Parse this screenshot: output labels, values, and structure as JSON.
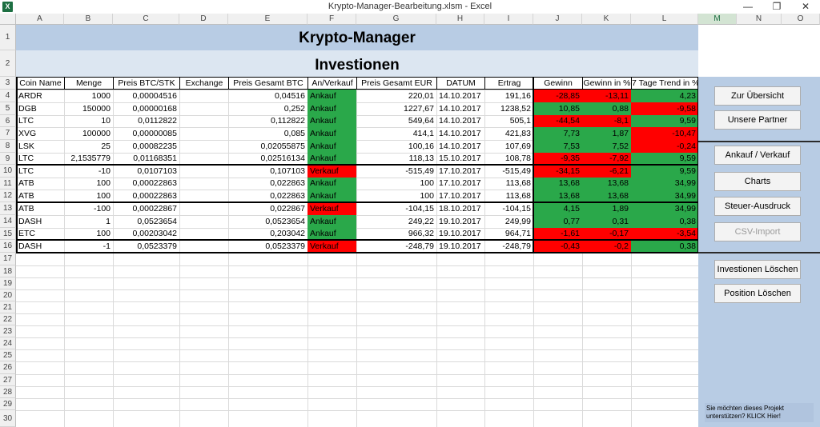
{
  "window": {
    "logo": "X",
    "title": "Krypto-Manager-Bearbeitung.xlsm - Excel",
    "controls": {
      "minimize": "—",
      "restore": "❐",
      "close": "✕"
    }
  },
  "columns": [
    "A",
    "B",
    "C",
    "D",
    "E",
    "F",
    "G",
    "H",
    "I",
    "J",
    "K",
    "L",
    "M",
    "N",
    "O"
  ],
  "row_numbers": [
    "1",
    "2",
    "3",
    "4",
    "5",
    "6",
    "7",
    "8",
    "9",
    "10",
    "11",
    "12",
    "13",
    "14",
    "15",
    "16",
    "17",
    "18",
    "19",
    "20",
    "21",
    "22",
    "23",
    "24",
    "25",
    "26",
    "27",
    "28",
    "29",
    "30"
  ],
  "sheet": {
    "title": "Krypto-Manager",
    "subtitle": "Investionen",
    "headers": [
      "Coin Name",
      "Menge",
      "Preis BTC/STK",
      "Exchange",
      "Preis Gesamt BTC",
      "An/Verkauf",
      "Preis Gesamt EUR",
      "DATUM",
      "Ertrag",
      "Gewinn",
      "Gewinn in %",
      "7 Tage Trend in %"
    ],
    "rows": [
      {
        "coin": "ARDR",
        "menge": "1000",
        "preis_stk": "0,00004516",
        "exchange": "",
        "gesamt_btc": "0,04516",
        "type": "Ankauf",
        "gesamt_eur": "220,01",
        "datum": "14.10.2017",
        "ertrag": "191,16",
        "gewinn": "-28,85",
        "gewinn_pct": "-13,11",
        "trend": "4,23"
      },
      {
        "coin": "DGB",
        "menge": "150000",
        "preis_stk": "0,00000168",
        "exchange": "",
        "gesamt_btc": "0,252",
        "type": "Ankauf",
        "gesamt_eur": "1227,67",
        "datum": "14.10.2017",
        "ertrag": "1238,52",
        "gewinn": "10,85",
        "gewinn_pct": "0,88",
        "trend": "-9,58"
      },
      {
        "coin": "LTC",
        "menge": "10",
        "preis_stk": "0,0112822",
        "exchange": "",
        "gesamt_btc": "0,112822",
        "type": "Ankauf",
        "gesamt_eur": "549,64",
        "datum": "14.10.2017",
        "ertrag": "505,1",
        "gewinn": "-44,54",
        "gewinn_pct": "-8,1",
        "trend": "9,59"
      },
      {
        "coin": "XVG",
        "menge": "100000",
        "preis_stk": "0,00000085",
        "exchange": "",
        "gesamt_btc": "0,085",
        "type": "Ankauf",
        "gesamt_eur": "414,1",
        "datum": "14.10.2017",
        "ertrag": "421,83",
        "gewinn": "7,73",
        "gewinn_pct": "1,87",
        "trend": "-10,47"
      },
      {
        "coin": "LSK",
        "menge": "25",
        "preis_stk": "0,00082235",
        "exchange": "",
        "gesamt_btc": "0,02055875",
        "type": "Ankauf",
        "gesamt_eur": "100,16",
        "datum": "14.10.2017",
        "ertrag": "107,69",
        "gewinn": "7,53",
        "gewinn_pct": "7,52",
        "trend": "-0,24"
      },
      {
        "coin": "LTC",
        "menge": "2,1535779",
        "preis_stk": "0,01168351",
        "exchange": "",
        "gesamt_btc": "0,02516134",
        "type": "Ankauf",
        "gesamt_eur": "118,13",
        "datum": "15.10.2017",
        "ertrag": "108,78",
        "gewinn": "-9,35",
        "gewinn_pct": "-7,92",
        "trend": "9,59"
      },
      {
        "coin": "LTC",
        "menge": "-10",
        "preis_stk": "0,0107103",
        "exchange": "",
        "gesamt_btc": "0,107103",
        "type": "Verkauf",
        "gesamt_eur": "-515,49",
        "datum": "17.10.2017",
        "ertrag": "-515,49",
        "gewinn": "-34,15",
        "gewinn_pct": "-6,21",
        "trend": "9,59"
      },
      {
        "coin": "ATB",
        "menge": "100",
        "preis_stk": "0,00022863",
        "exchange": "",
        "gesamt_btc": "0,022863",
        "type": "Ankauf",
        "gesamt_eur": "100",
        "datum": "17.10.2017",
        "ertrag": "113,68",
        "gewinn": "13,68",
        "gewinn_pct": "13,68",
        "trend": "34,99"
      },
      {
        "coin": "ATB",
        "menge": "100",
        "preis_stk": "0,00022863",
        "exchange": "",
        "gesamt_btc": "0,022863",
        "type": "Ankauf",
        "gesamt_eur": "100",
        "datum": "17.10.2017",
        "ertrag": "113,68",
        "gewinn": "13,68",
        "gewinn_pct": "13,68",
        "trend": "34,99"
      },
      {
        "coin": "ATB",
        "menge": "-100",
        "preis_stk": "0,00022867",
        "exchange": "",
        "gesamt_btc": "0,022867",
        "type": "Verkauf",
        "gesamt_eur": "-104,15",
        "datum": "18.10.2017",
        "ertrag": "-104,15",
        "gewinn": "4,15",
        "gewinn_pct": "1,89",
        "trend": "34,99"
      },
      {
        "coin": "DASH",
        "menge": "1",
        "preis_stk": "0,0523654",
        "exchange": "",
        "gesamt_btc": "0,0523654",
        "type": "Ankauf",
        "gesamt_eur": "249,22",
        "datum": "19.10.2017",
        "ertrag": "249,99",
        "gewinn": "0,77",
        "gewinn_pct": "0,31",
        "trend": "0,38"
      },
      {
        "coin": "ETC",
        "menge": "100",
        "preis_stk": "0,00203042",
        "exchange": "",
        "gesamt_btc": "0,203042",
        "type": "Ankauf",
        "gesamt_eur": "966,32",
        "datum": "19.10.2017",
        "ertrag": "964,71",
        "gewinn": "-1,61",
        "gewinn_pct": "-0,17",
        "trend": "-3,54"
      },
      {
        "coin": "DASH",
        "menge": "-1",
        "preis_stk": "0,0523379",
        "exchange": "",
        "gesamt_btc": "0,0523379",
        "type": "Verkauf",
        "gesamt_eur": "-248,79",
        "datum": "19.10.2017",
        "ertrag": "-248,79",
        "gewinn": "-0,43",
        "gewinn_pct": "-0,2",
        "trend": "0,38"
      }
    ]
  },
  "panel": {
    "buttons": [
      {
        "label": "Zur Übersicht",
        "enabled": true
      },
      {
        "label": "Unsere Partner",
        "enabled": true
      },
      {
        "label": "Ankauf / Verkauf",
        "enabled": true
      },
      {
        "label": "Charts",
        "enabled": true
      },
      {
        "label": "Steuer-Ausdruck",
        "enabled": true
      },
      {
        "label": "CSV-Import",
        "enabled": false
      },
      {
        "label": "Investionen Löschen",
        "enabled": true
      },
      {
        "label": "Position Löschen",
        "enabled": true
      }
    ],
    "note": "Sie möchten dieses Projekt unterstützen?    KLICK Hier!"
  },
  "colors": {
    "positive": "#2aa84a",
    "negative": "#ff0000",
    "band_dark": "#b8cce4",
    "band_light": "#dce6f1",
    "sheet_header_selected": "#1d6f42"
  }
}
